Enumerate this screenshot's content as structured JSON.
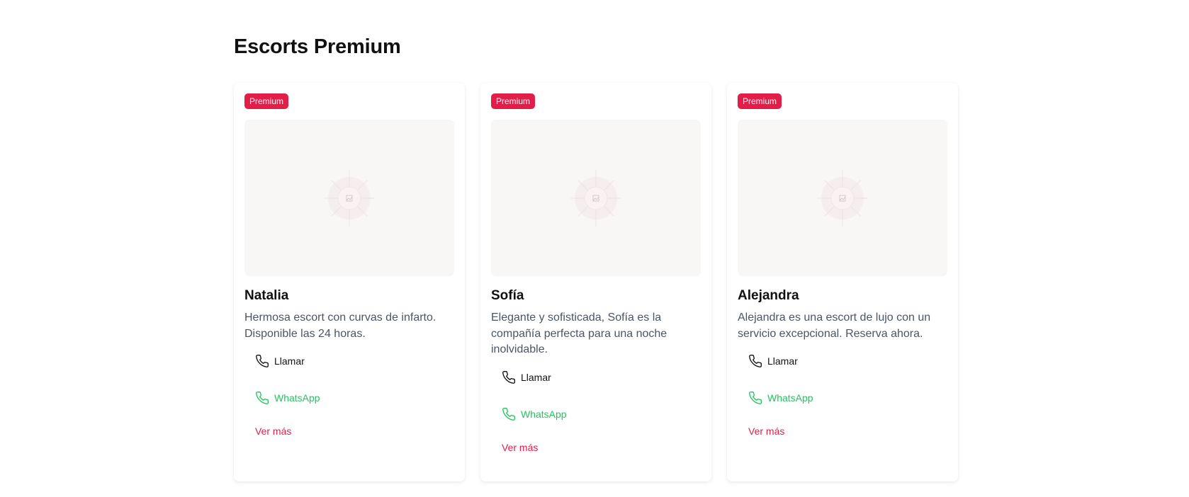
{
  "section": {
    "title": "Escorts Premium"
  },
  "cards": [
    {
      "badge": "Premium",
      "name": "Natalia",
      "description": "Hermosa escort con curvas de infarto. Disponible las 24 horas.",
      "call_label": "Llamar",
      "whatsapp_label": "WhatsApp",
      "more_label": "Ver más"
    },
    {
      "badge": "Premium",
      "name": "Sofía",
      "description": "Elegante y sofisticada, Sofía es la compañía perfecta para una noche inolvidable.",
      "call_label": "Llamar",
      "whatsapp_label": "WhatsApp",
      "more_label": "Ver más"
    },
    {
      "badge": "Premium",
      "name": "Alejandra",
      "description": "Alejandra es una escort de lujo con un servicio excepcional. Reserva ahora.",
      "call_label": "Llamar",
      "whatsapp_label": "WhatsApp",
      "more_label": "Ver más"
    }
  ],
  "icons": {
    "call": "phone-icon",
    "whatsapp": "phone-icon",
    "image": "image-placeholder-icon"
  },
  "colors": {
    "accent": "#e11d48",
    "whatsapp": "#22c55e",
    "text": "#111111",
    "muted": "#4b5563",
    "image_bg": "#f9f6f6"
  }
}
